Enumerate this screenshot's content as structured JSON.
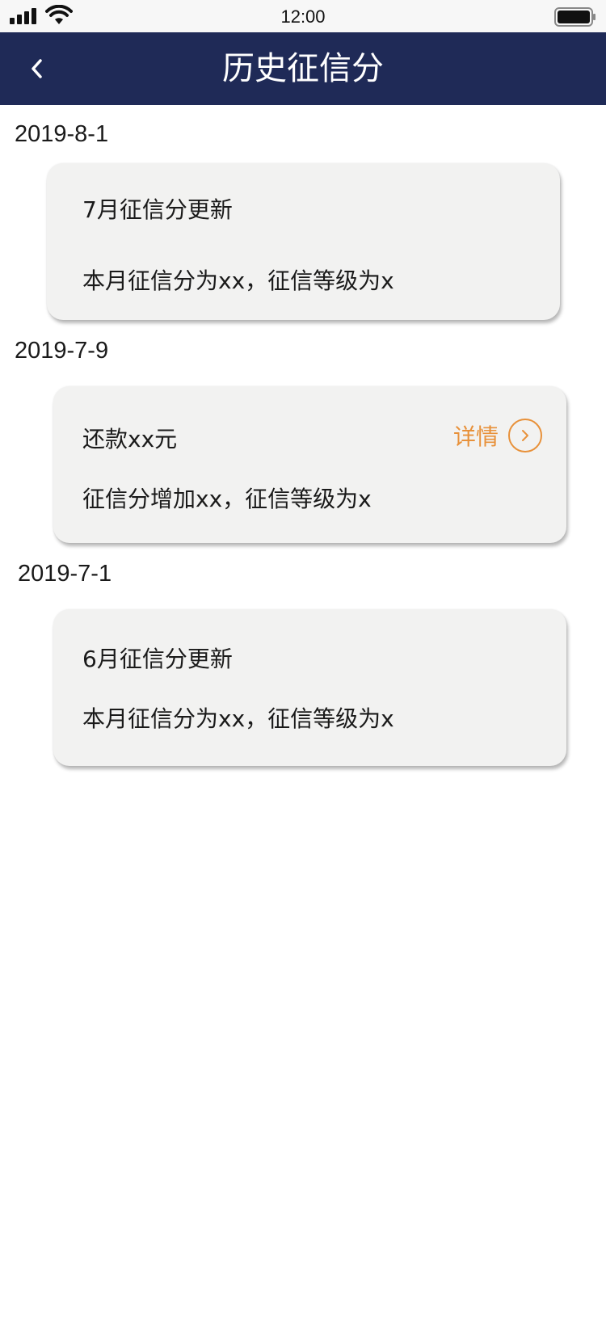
{
  "status_bar": {
    "time": "12:00",
    "signal_icon": "cellular-signal-icon",
    "wifi_icon": "wifi-icon",
    "battery_icon": "battery-icon"
  },
  "nav": {
    "title": "历史征信分",
    "back_icon": "chevron-left-icon",
    "background_color": "#1f2a57"
  },
  "records": [
    {
      "date": "2019-8-1",
      "title": "7月征信分更新",
      "description": "本月征信分为xx，征信等级为x"
    },
    {
      "date": "2019-7-9",
      "title": "还款xx元",
      "description": "征信分增加xx，征信等级为x",
      "detail_label": "详情",
      "detail_icon": "chevron-right-circle-icon",
      "detail_color": "#e8913a"
    },
    {
      "date": "2019-7-1",
      "title": "6月征信分更新",
      "description": "本月征信分为xx，征信等级为x"
    }
  ]
}
